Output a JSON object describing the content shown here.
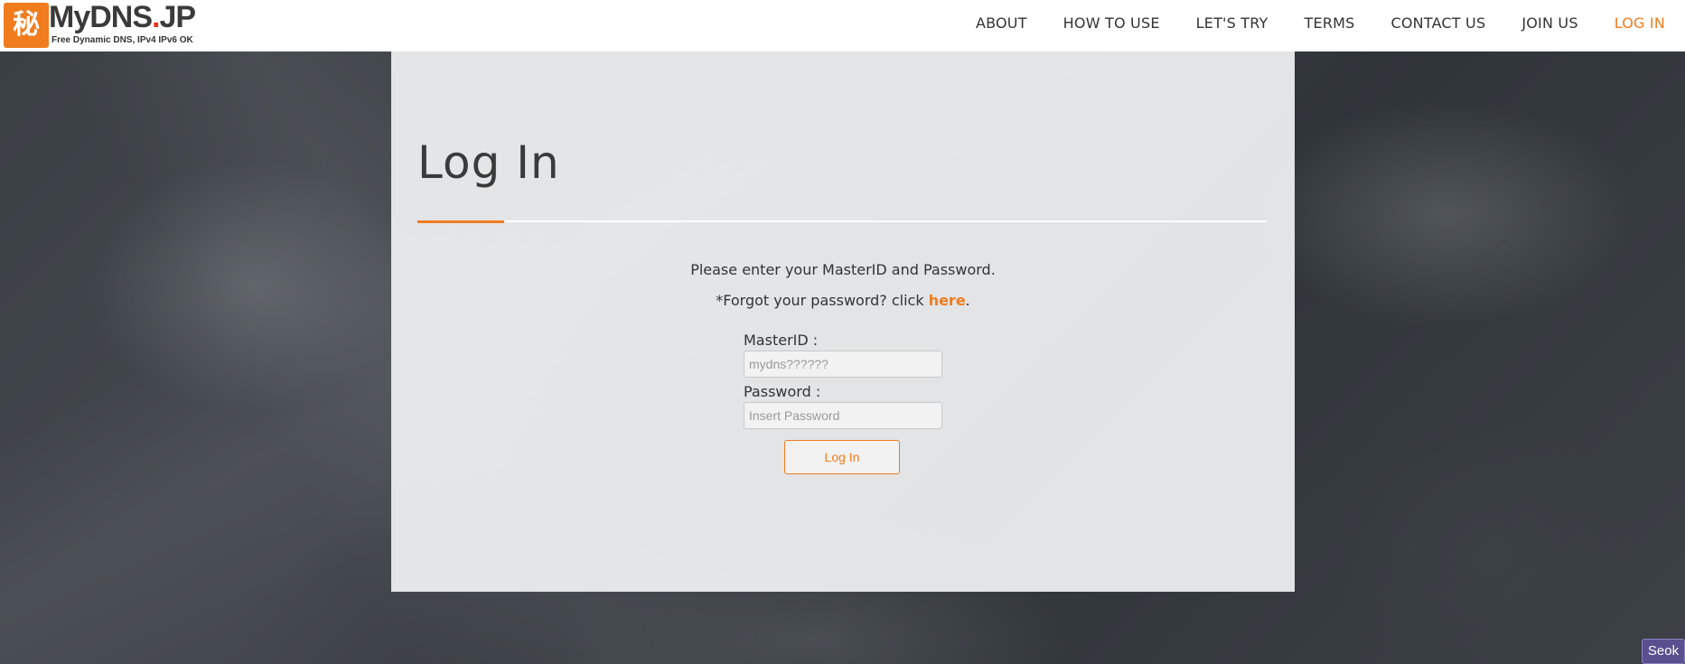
{
  "header": {
    "logo_mark": "秘",
    "logo_title": "MyDNS",
    "logo_dot": ".",
    "logo_title_suffix": "JP",
    "logo_subtitle": "Free Dynamic DNS, IPv4 IPv6 OK",
    "nav": [
      {
        "label": "ABOUT"
      },
      {
        "label": "HOW TO USE"
      },
      {
        "label": "LET'S TRY"
      },
      {
        "label": "TERMS"
      },
      {
        "label": "CONTACT US"
      },
      {
        "label": "JOIN US"
      },
      {
        "label": "LOG IN",
        "active": true
      }
    ]
  },
  "login": {
    "title": "Log In",
    "instruction": "Please enter your MasterID and Password.",
    "forgot_prefix": "*Forgot your password? click ",
    "forgot_link": "here",
    "forgot_suffix": ".",
    "masterid_label": "MasterID :",
    "masterid_placeholder": "mydns??????",
    "password_label": "Password :",
    "password_placeholder": "Insert Password",
    "submit_label": "Log In"
  },
  "badge": {
    "label": "Seok"
  },
  "colors": {
    "accent": "#f07c1e",
    "text": "#333333"
  }
}
